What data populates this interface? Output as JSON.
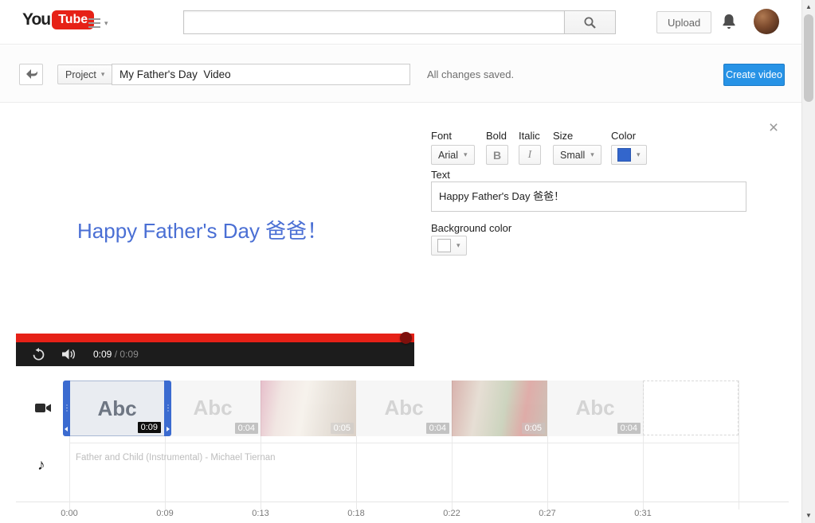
{
  "header": {
    "logo": {
      "part1": "You",
      "part2": "Tube"
    },
    "search_value": "",
    "upload_label": "Upload"
  },
  "toolbar": {
    "project_label": "Project",
    "title_value": "My Father's Day  Video",
    "status_text": "All changes saved.",
    "create_label": "Create video"
  },
  "text_overlay_panel": {
    "font_label": "Font",
    "font_value": "Arial",
    "bold_label": "Bold",
    "bold_glyph": "B",
    "italic_label": "Italic",
    "italic_glyph": "I",
    "size_label": "Size",
    "size_value": "Small",
    "color_label": "Color",
    "text_label": "Text",
    "text_value": "Happy Father's Day 爸爸！",
    "background_label": "Background color"
  },
  "preview": {
    "text": "Happy Father's Day 爸爸！"
  },
  "player": {
    "current_time": "0:09",
    "separator": "/",
    "total_time": "0:09"
  },
  "timeline": {
    "clips": [
      {
        "kind": "text",
        "label": "Abc",
        "duration": "0:09",
        "selected": true
      },
      {
        "kind": "text",
        "label": "Abc",
        "duration": "0:04",
        "selected": false
      },
      {
        "kind": "photo",
        "label": "",
        "duration": "0:05",
        "selected": false
      },
      {
        "kind": "text",
        "label": "Abc",
        "duration": "0:04",
        "selected": false
      },
      {
        "kind": "photo",
        "label": "",
        "duration": "0:05",
        "selected": false
      },
      {
        "kind": "text",
        "label": "Abc",
        "duration": "0:04",
        "selected": false
      }
    ],
    "audio_track_title": "Father and Child (Instrumental) - Michael Tiernan",
    "ruler_labels": [
      "0:00",
      "0:09",
      "0:13",
      "0:18",
      "0:22",
      "0:27",
      "0:31"
    ]
  },
  "colors": {
    "youtube_red": "#e62117",
    "create_button_blue": "#2793e6",
    "preview_text_blue": "#4a6fd4",
    "text_color_swatch": "#3366cc",
    "selection_handle_blue": "#3b6bd0"
  }
}
